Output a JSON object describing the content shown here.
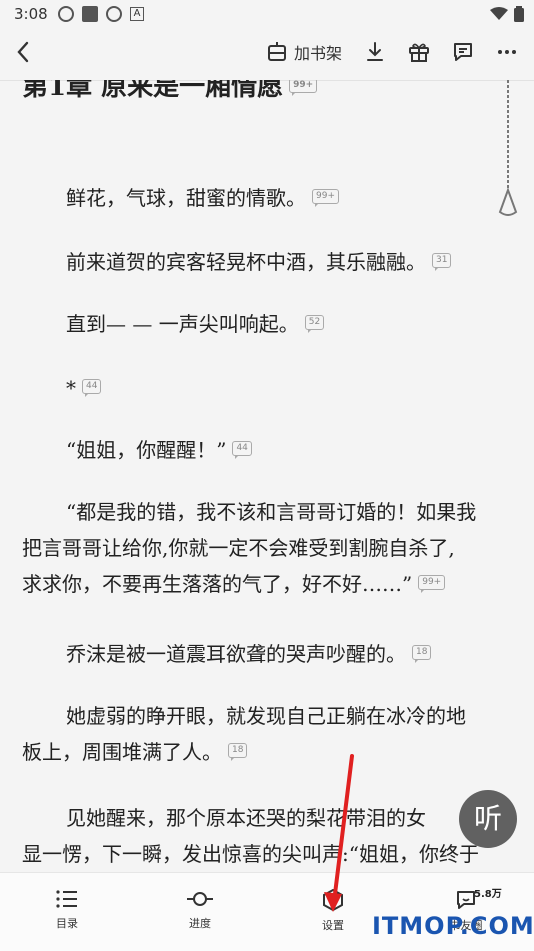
{
  "status_bar": {
    "time": "3:08",
    "a_icon": "A"
  },
  "toolbar": {
    "add_shelf_label": "加书架"
  },
  "chapter": {
    "title": "第1章 原来是一厢情愿",
    "title_bubble": "99+"
  },
  "paragraphs": [
    {
      "lines": [
        "鲜花，气球，甜蜜的情歌。"
      ],
      "count": "99+"
    },
    {
      "lines": [
        "前来道贺的宾客轻晃杯中酒，其乐融融。"
      ],
      "count": "31"
    },
    {
      "lines": [
        "直到— — 一声尖叫响起。"
      ],
      "count": "52"
    },
    {
      "lines": [
        "*"
      ],
      "count": "44"
    },
    {
      "lines": [
        "“姐姐，你醒醒！”"
      ],
      "count": "44"
    },
    {
      "lines": [
        "“都是我的错，我不该和言哥哥订婚的！如果我",
        "把言哥哥让给你,你就一定不会难受到割腕自杀了,",
        "求求你，不要再生落落的气了，好不好……”"
      ],
      "count": "99+"
    },
    {
      "lines": [
        "乔沫是被一道震耳欲聋的哭声吵醒的。"
      ],
      "count": "18"
    },
    {
      "lines": [
        "她虚弱的睁开眼，就发现自己正躺在冰冷的地",
        "板上，周围堆满了人。"
      ],
      "count": "18"
    },
    {
      "lines": [
        "见她醒来，那个原本还哭的梨花带泪的女",
        "显一愣，下一瞬，发出惊喜的尖叫声:“姐姐，你终于"
      ],
      "count": ""
    }
  ],
  "listen_button": {
    "label": "听"
  },
  "bottom_nav": [
    {
      "label": "目录",
      "icon": "list-icon"
    },
    {
      "label": "进度",
      "icon": "progress-icon"
    },
    {
      "label": "设置",
      "icon": "settings-icon"
    },
    {
      "label": "书友圈",
      "icon": "comment-icon",
      "badge": "5.8万"
    }
  ],
  "watermark": "ITMOP.COM",
  "colors": {
    "background": "#f4f4f4",
    "text": "#222222",
    "arrow": "#e02020",
    "watermark": "#1a55b0"
  }
}
